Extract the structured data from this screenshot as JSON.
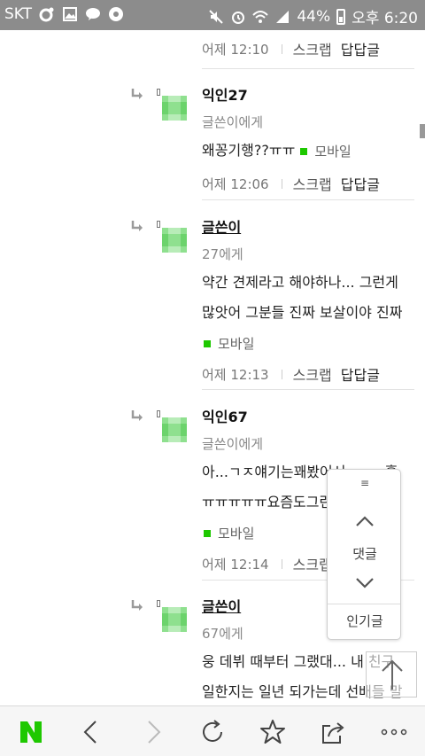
{
  "status_bar": {
    "carrier": "SKT",
    "battery": "44%",
    "time": "오후 6:20"
  },
  "top_meta": {
    "time": "어제 12:10",
    "scrap": "스크랩",
    "reply": "답답글"
  },
  "comments": [
    {
      "author": "익인27",
      "target": "글쓴이에게",
      "line1": "왜꽁기행??ㅠㅠ",
      "mobile": "모바일",
      "time": "어제 12:06",
      "scrap": "스크랩",
      "reply": "답답글"
    },
    {
      "author": "글쓴이",
      "target": "27에게",
      "line1": "약간 견제라고 해야하나... 그런게",
      "line2": "많앗어 그분들 진짜 보살이야 진짜",
      "mobile": "모바일",
      "time": "어제 12:13",
      "scrap": "스크랩",
      "reply": "답답글"
    },
    {
      "author": "익인67",
      "target": "글쓴이에게",
      "line1": "아...ㄱㅈ얘기는꽤봤어서ㅜㅜㅜ흫",
      "line2": "ㅠㅠㅠㅠㅠ요즘도그런",
      "mobile": "모바일",
      "time": "어제 12:14",
      "scrap": "스크랩"
    },
    {
      "author": "글쓴이",
      "target": "67에게",
      "line1": "웅 데뷔 때부터 그랬대... 내 친구",
      "line2": "일한지는 일년 되가는데 선배들 말"
    }
  ],
  "float_nav": {
    "menu": "≡",
    "comments": "댓글",
    "popular": "인기글"
  },
  "toolbar": {
    "home": "N-logo-icon",
    "back": "back-chevron-icon",
    "forward": "forward-chevron-icon",
    "refresh": "refresh-icon",
    "bookmark": "star-icon",
    "share": "share-icon",
    "more": "more-dots-icon"
  },
  "colors": {
    "brand_green": "#1ec800",
    "avatar_green": "#7ed87e",
    "status_bar": "#8c8c8c"
  }
}
